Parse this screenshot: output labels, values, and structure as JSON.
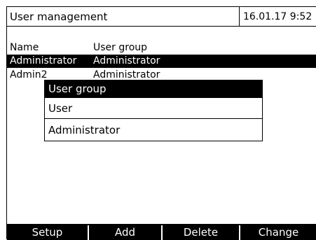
{
  "header": {
    "title": "User management",
    "datetime": "16.01.17  9:52"
  },
  "table": {
    "columns": [
      "Name",
      "User group"
    ],
    "rows": [
      {
        "name": "Administrator",
        "group": "Administrator",
        "selected": true
      },
      {
        "name": "Admin2",
        "group": "Administrator",
        "selected": false
      }
    ]
  },
  "popup": {
    "title": "User group",
    "options": [
      "User",
      "Administrator"
    ]
  },
  "softkeys": [
    "Setup",
    "Add",
    "Delete",
    "Change"
  ]
}
